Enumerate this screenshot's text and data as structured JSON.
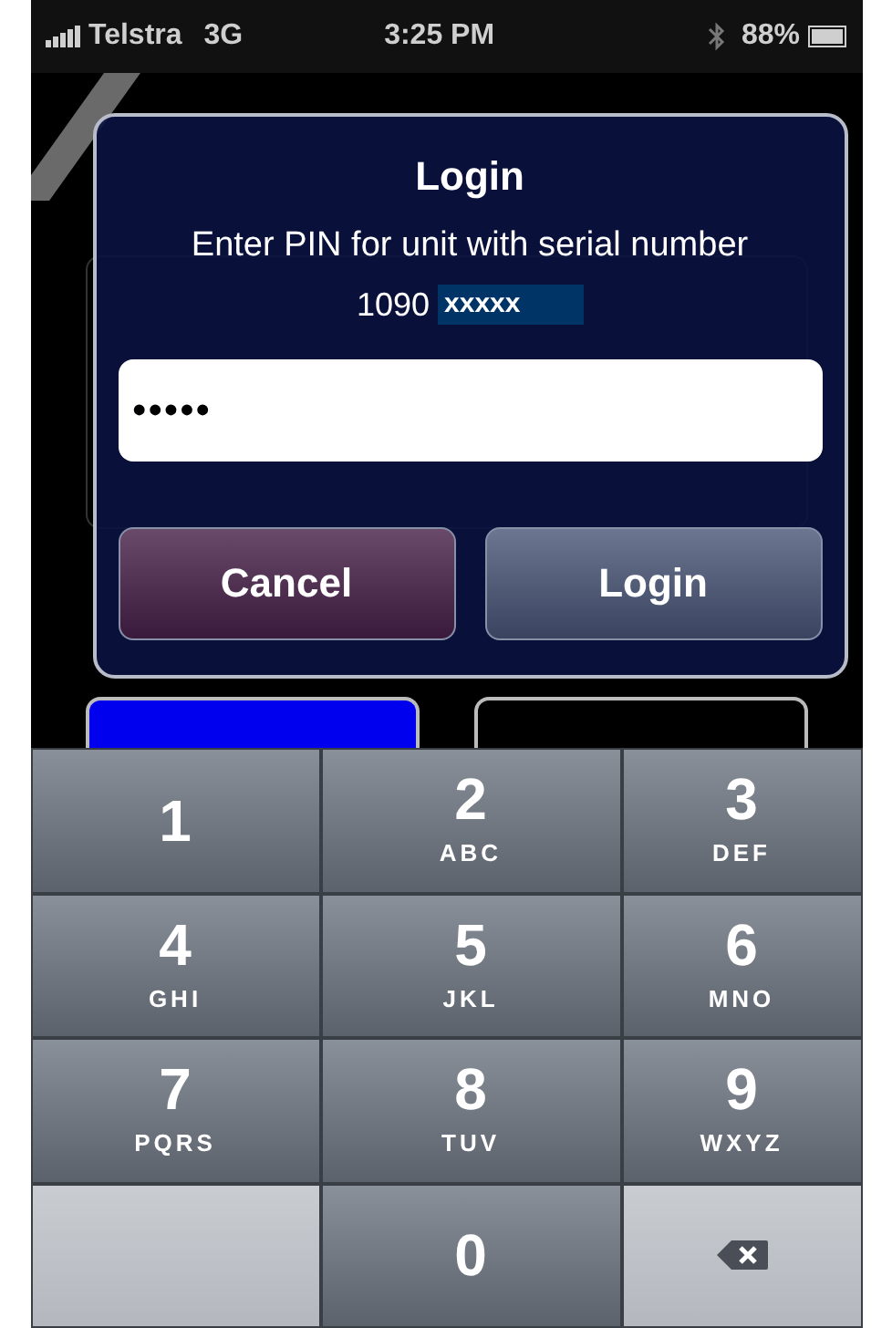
{
  "status_bar": {
    "carrier": "Telstra",
    "network": "3G",
    "time": "3:25 PM",
    "battery": "88%"
  },
  "dialog": {
    "title": "Login",
    "message": "Enter PIN for unit with serial number",
    "serial": "1090",
    "serial_masked": "xxxxx",
    "pin_value": "•••••",
    "buttons": [
      {
        "label": "Cancel",
        "kind": "cancel"
      },
      {
        "label": "Login",
        "kind": "confirm"
      }
    ]
  },
  "keypad": [
    {
      "kind": "digit",
      "digit": "1"
    },
    {
      "kind": "digit",
      "digit": "2",
      "letters": "ABC"
    },
    {
      "kind": "digit",
      "digit": "3",
      "letters": "DEF"
    },
    {
      "kind": "digit",
      "digit": "4",
      "letters": "GHI"
    },
    {
      "kind": "digit",
      "digit": "5",
      "letters": "JKL"
    },
    {
      "kind": "digit",
      "digit": "6",
      "letters": "MNO"
    },
    {
      "kind": "digit",
      "digit": "7",
      "letters": "PQRS"
    },
    {
      "kind": "digit",
      "digit": "8",
      "letters": "TUV"
    },
    {
      "kind": "digit",
      "digit": "9",
      "letters": "WXYZ"
    },
    {
      "kind": "blank"
    },
    {
      "kind": "digit",
      "digit": "0"
    },
    {
      "kind": "delete"
    }
  ]
}
